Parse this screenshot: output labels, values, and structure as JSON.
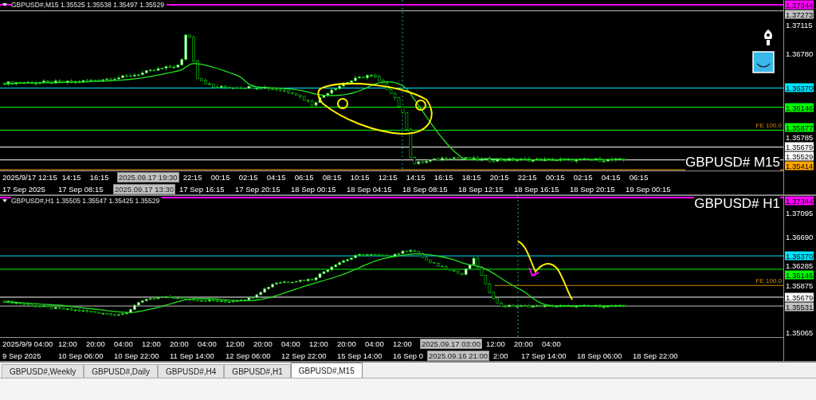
{
  "panels": [
    {
      "kind": "M15",
      "header": "GBPUSD#,M15  1.35525 1.35538 1.35497 1.35529",
      "title": "GBPUSD# M15",
      "price_labels": [
        {
          "text": "1.37344",
          "color": "#ff00ff"
        },
        {
          "text": "1.37273",
          "color": "#c0c0c0"
        },
        {
          "text": "1.37115"
        },
        {
          "text": "1.36780"
        },
        {
          "text": "1.36370",
          "color": "#00e5ff"
        },
        {
          "text": "1.36146",
          "color": "#00ff00"
        },
        {
          "text": "1.35877",
          "color": "#00ff00",
          "note": "FE 100.0"
        },
        {
          "text": "1.35785"
        },
        {
          "text": "1.35679",
          "color": "#ffffff"
        },
        {
          "text": "1.35529",
          "color": "#ffffff"
        },
        {
          "text": "1.35414",
          "color": "#ffa500"
        }
      ],
      "time_row_1": [
        {
          "text": "2025/9/17 12:15",
          "kind": "date"
        },
        {
          "text": "14:15",
          "kind": "tick"
        },
        {
          "text": "16:15",
          "kind": "tick"
        },
        {
          "text": "2025.09.17 19:30",
          "kind": "highlight"
        },
        {
          "text": "22:15",
          "kind": "tick"
        },
        {
          "text": "00:15",
          "kind": "tick"
        },
        {
          "text": "02:15",
          "kind": "tick"
        },
        {
          "text": "04:15",
          "kind": "tick"
        },
        {
          "text": "06:15",
          "kind": "tick"
        },
        {
          "text": "08:15",
          "kind": "tick"
        },
        {
          "text": "10:15",
          "kind": "tick"
        },
        {
          "text": "12:15",
          "kind": "tick"
        },
        {
          "text": "14:15",
          "kind": "tick"
        },
        {
          "text": "16:15",
          "kind": "tick"
        },
        {
          "text": "18:15",
          "kind": "tick"
        },
        {
          "text": "20:15",
          "kind": "tick"
        },
        {
          "text": "22:15",
          "kind": "tick"
        },
        {
          "text": "00:15",
          "kind": "tick"
        },
        {
          "text": "02:15",
          "kind": "tick"
        },
        {
          "text": "04:15",
          "kind": "tick"
        },
        {
          "text": "06:15",
          "kind": "tick"
        }
      ],
      "time_row_2": [
        {
          "text": "17 Sep 2025",
          "kind": "date"
        },
        {
          "text": "17 Sep 08:15",
          "kind": "date"
        },
        {
          "text": "2025.09.17 13:30",
          "kind": "highlight"
        },
        {
          "text": "17 Sep 16:15",
          "kind": "date"
        },
        {
          "text": "17 Sep 20:15",
          "kind": "date"
        },
        {
          "text": "18 Sep 00:15",
          "kind": "date"
        },
        {
          "text": "18 Sep 04:15",
          "kind": "date"
        },
        {
          "text": "18 Sep 08:15",
          "kind": "date"
        },
        {
          "text": "18 Sep 12:15",
          "kind": "date"
        },
        {
          "text": "18 Sep 16:15",
          "kind": "date"
        },
        {
          "text": "18 Sep 20:15",
          "kind": "date"
        },
        {
          "text": "19 Sep 00:15",
          "kind": "date"
        }
      ]
    },
    {
      "kind": "H1",
      "header": "GBPUSD#,H1  1.35505 1.35547 1.35425 1.35529",
      "title": "GBPUSD# H1",
      "price_labels": [
        {
          "text": "1.37344",
          "color": "#ff00ff"
        },
        {
          "text": "1.37095"
        },
        {
          "text": "1.36690"
        },
        {
          "text": "1.36370",
          "color": "#00e5ff"
        },
        {
          "text": "1.36285"
        },
        {
          "text": "1.36146",
          "color": "#00ff00"
        },
        {
          "text": "1.35875",
          "note": "FE 100.0"
        },
        {
          "text": "1.35679",
          "color": "#ffffff"
        },
        {
          "text": "1.35531",
          "color": "#c0c0c0"
        },
        {
          "text": "1.35065"
        }
      ],
      "time_row_1": [
        {
          "text": "2025/9/9 04:00",
          "kind": "date"
        },
        {
          "text": "12:00",
          "kind": "tick"
        },
        {
          "text": "20:00",
          "kind": "tick"
        },
        {
          "text": "04:00",
          "kind": "tick"
        },
        {
          "text": "12:00",
          "kind": "tick"
        },
        {
          "text": "20:00",
          "kind": "tick"
        },
        {
          "text": "04:00",
          "kind": "tick"
        },
        {
          "text": "12:00",
          "kind": "tick"
        },
        {
          "text": "20:00",
          "kind": "tick"
        },
        {
          "text": "04:00",
          "kind": "tick"
        },
        {
          "text": "12:00",
          "kind": "tick"
        },
        {
          "text": "20:00",
          "kind": "tick"
        },
        {
          "text": "04:00",
          "kind": "tick"
        },
        {
          "text": "12:00",
          "kind": "tick"
        },
        {
          "text": "2025.09.17 03:00",
          "kind": "highlight"
        },
        {
          "text": "12:00",
          "kind": "tick"
        },
        {
          "text": "20:00",
          "kind": "tick"
        },
        {
          "text": "04:00",
          "kind": "tick"
        }
      ],
      "time_row_2": [
        {
          "text": "9 Sep 2025",
          "kind": "date"
        },
        {
          "text": "10 Sep 06:00",
          "kind": "date"
        },
        {
          "text": "10 Sep 22:00",
          "kind": "date"
        },
        {
          "text": "11 Sep 14:00",
          "kind": "date"
        },
        {
          "text": "12 Sep 06:00",
          "kind": "date"
        },
        {
          "text": "12 Sep 22:00",
          "kind": "date"
        },
        {
          "text": "15 Sep 14:00",
          "kind": "date"
        },
        {
          "text": "16 Sep 0",
          "kind": "cut"
        },
        {
          "text": "2025.09.16 21:00",
          "kind": "highlight"
        },
        {
          "text": "2:00",
          "kind": "cut"
        },
        {
          "text": "17 Sep 14:00",
          "kind": "date"
        },
        {
          "text": "18 Sep 06:00",
          "kind": "date"
        },
        {
          "text": "18 Sep 22:00",
          "kind": "date"
        }
      ]
    }
  ],
  "tabs": [
    {
      "label": "GBPUSD#,Weekly",
      "selected": false
    },
    {
      "label": "GBPUSD#,Daily",
      "selected": false
    },
    {
      "label": "GBPUSD#,H4",
      "selected": false
    },
    {
      "label": "GBPUSD#,H1",
      "selected": false
    },
    {
      "label": "GBPUSD#,M15",
      "selected": true
    }
  ]
}
